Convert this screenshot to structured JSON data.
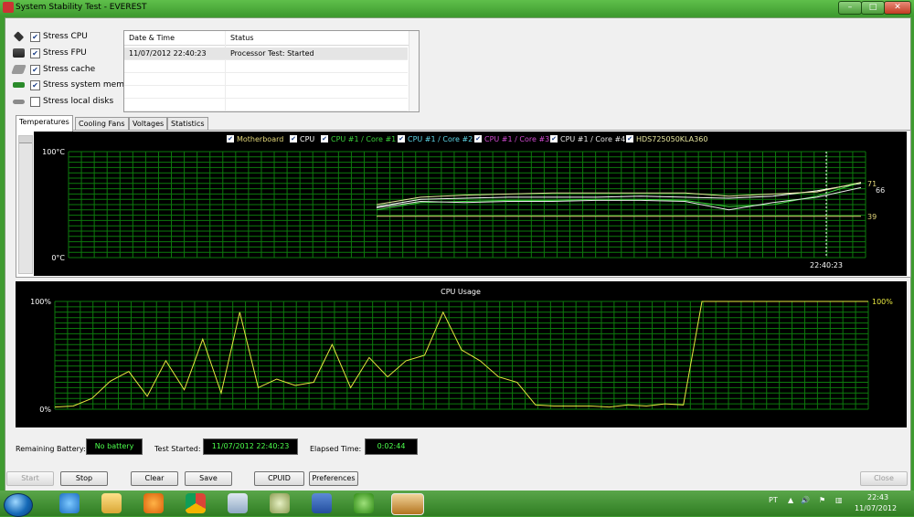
{
  "window": {
    "title": "System Stability Test - EVEREST"
  },
  "stress_options": [
    {
      "label": "Stress CPU",
      "checked": true,
      "icon": "cpu-icon"
    },
    {
      "label": "Stress FPU",
      "checked": true,
      "icon": "fpu-icon"
    },
    {
      "label": "Stress cache",
      "checked": true,
      "icon": "cache-icon"
    },
    {
      "label": "Stress system memory",
      "checked": true,
      "icon": "memory-icon"
    },
    {
      "label": "Stress local disks",
      "checked": false,
      "icon": "disk-icon"
    }
  ],
  "status_table": {
    "headers": [
      "Date & Time",
      "Status"
    ],
    "rows": [
      [
        "11/07/2012 22:40:23",
        "Processor Test: Started"
      ]
    ]
  },
  "tabs": [
    "Temperatures",
    "Cooling Fans",
    "Voltages",
    "Statistics"
  ],
  "active_tab": "Temperatures",
  "temp_chart": {
    "legend": [
      {
        "label": "Motherboard",
        "color": "#e3d77a"
      },
      {
        "label": "CPU",
        "color": "#ffffff"
      },
      {
        "label": "CPU #1 / Core #1",
        "color": "#3bd23b"
      },
      {
        "label": "CPU #1 / Core #2",
        "color": "#5fd7e8"
      },
      {
        "label": "CPU #1 / Core #3",
        "color": "#d24ad2"
      },
      {
        "label": "CPU #1 / Core #4",
        "color": "#e8e8e8"
      },
      {
        "label": "HDS725050KLA360",
        "color": "#e8e8a0"
      }
    ],
    "y_max_label": "100°C",
    "y_min_label": "0°C",
    "time_label": "22:40:23",
    "end_values": [
      "71",
      "66",
      "39"
    ]
  },
  "cpu_chart": {
    "title": "CPU Usage",
    "y_max_label": "100%",
    "y_min_label": "0%",
    "current_label": "100%"
  },
  "chart_data": [
    {
      "type": "line",
      "title": "",
      "ylim": [
        0,
        100
      ],
      "series": [
        {
          "name": "Motherboard",
          "values": [
            39,
            39,
            39,
            39,
            39,
            39,
            39,
            39,
            39,
            39,
            39,
            39
          ]
        },
        {
          "name": "CPU",
          "values": [
            48,
            55,
            56,
            57,
            57,
            57,
            58,
            57,
            56,
            58,
            63,
            70
          ]
        },
        {
          "name": "CPU #1 / Core #1",
          "values": [
            45,
            52,
            53,
            54,
            54,
            55,
            55,
            54,
            48,
            50,
            58,
            71
          ]
        },
        {
          "name": "HDS725050KLA360",
          "values": [
            50,
            57,
            59,
            60,
            61,
            61,
            61,
            61,
            58,
            60,
            62,
            71
          ]
        },
        {
          "name": "CPU #1 / Core #4",
          "values": [
            47,
            53,
            52,
            53,
            53,
            54,
            54,
            53,
            45,
            52,
            57,
            66
          ]
        }
      ]
    },
    {
      "type": "line",
      "title": "CPU Usage",
      "ylim": [
        0,
        100
      ],
      "series": [
        {
          "name": "",
          "values": [
            2,
            3,
            10,
            26,
            35,
            12,
            45,
            18,
            65,
            15,
            90,
            20,
            28,
            22,
            25,
            60,
            20,
            48,
            30,
            45,
            50,
            90,
            55,
            45,
            30,
            25,
            4,
            3,
            3,
            3,
            2,
            4,
            3,
            5,
            4,
            100,
            100,
            100,
            100,
            100,
            100,
            100,
            100,
            100,
            100
          ]
        }
      ]
    }
  ],
  "status_bar": {
    "battery_label": "Remaining Battery:",
    "battery_value": "No battery",
    "started_label": "Test Started:",
    "started_value": "11/07/2012 22:40:23",
    "elapsed_label": "Elapsed Time:",
    "elapsed_value": "0:02:44"
  },
  "buttons": {
    "start": "Start",
    "stop": "Stop",
    "clear": "Clear",
    "save": "Save",
    "cpuid": "CPUID",
    "preferences": "Preferences",
    "close": "Close"
  },
  "taskbar": {
    "lang": "PT",
    "time": "22:43",
    "date": "11/07/2012"
  }
}
